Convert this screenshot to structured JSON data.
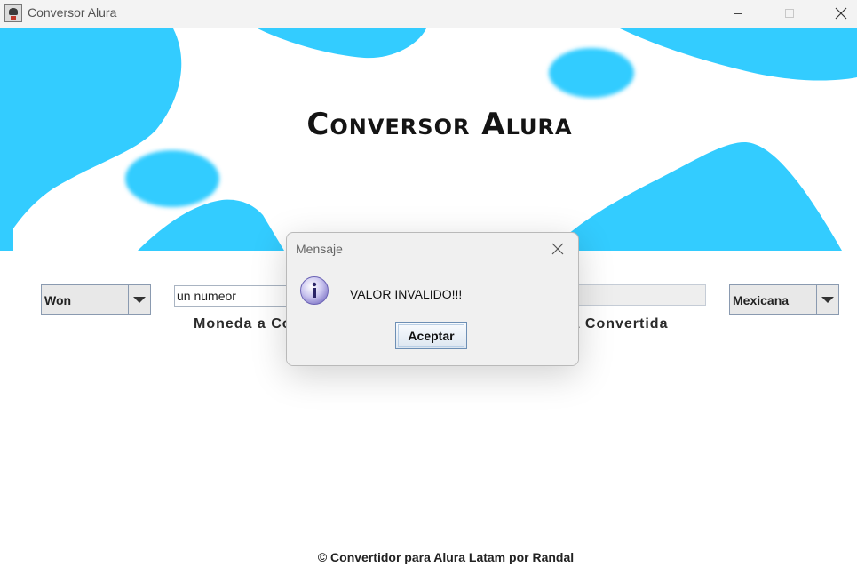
{
  "window": {
    "title": "Conversor Alura",
    "icon": "app-icon",
    "controls": [
      "minimize-icon",
      "maximize-icon",
      "close-icon"
    ]
  },
  "header": {
    "heading": "Conversor Alura"
  },
  "converter": {
    "from_currency": {
      "selected": "Won"
    },
    "amount_input": {
      "value": "un numeor"
    },
    "result_input": {
      "value": ""
    },
    "to_currency": {
      "selected": "Mexicana"
    },
    "from_label": "Moneda a Convertir",
    "to_label": "Moneda Convertida"
  },
  "footer": {
    "text": "© Convertidor para Alura Latam por Randal"
  },
  "dialog": {
    "title": "Mensaje",
    "icon": "info-icon",
    "message": "VALOR INVALIDO!!!",
    "ok_label": "Aceptar"
  },
  "colors": {
    "accent": "#33ccff",
    "background": "#ffffff",
    "titlebar": "#f3f3f3",
    "dialog_bg": "#f0f0f0"
  }
}
